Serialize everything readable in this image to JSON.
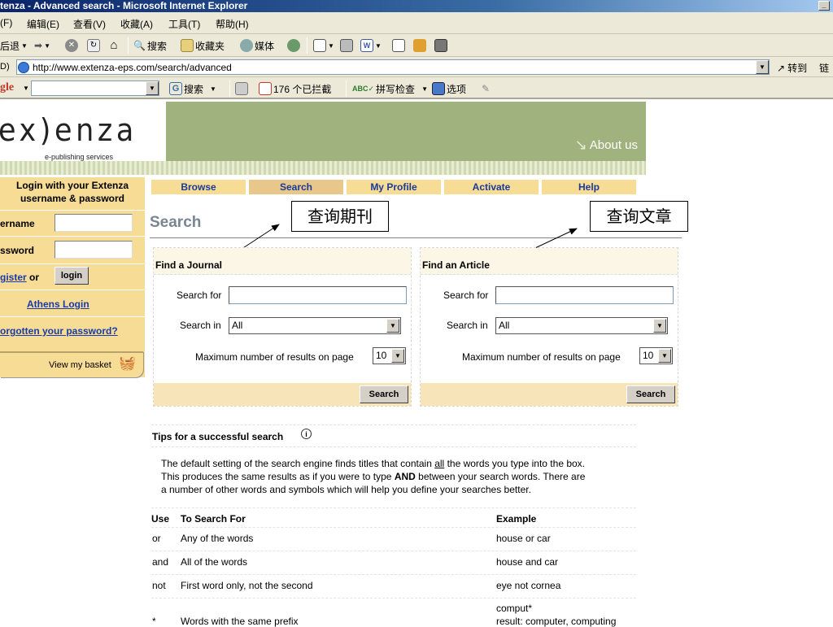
{
  "window": {
    "title": "tenza - Advanced search - Microsoft Internet Explorer"
  },
  "menu": [
    "(F)",
    "编辑(E)",
    "查看(V)",
    "收藏(A)",
    "工具(T)",
    "帮助(H)"
  ],
  "toolbar": {
    "back": "后退",
    "search": "搜索",
    "favorites": "收藏夹",
    "media": "媒体"
  },
  "address": {
    "label": "D)",
    "url": "http://www.extenza-eps.com/search/advanced",
    "go": "转到",
    "links": "链"
  },
  "google_bar": {
    "logo": "gle",
    "search": "搜索",
    "blocked": "176 个已拦截",
    "spell": "拼写检查",
    "options": "选项"
  },
  "site": {
    "logo": "ex)enza",
    "logo_sub": "e-publishing services",
    "about": "About us"
  },
  "login": {
    "heading_line1": "Login with your Extenza",
    "heading_line2": "username & password",
    "username_label": "ername",
    "password_label": "ssword",
    "register": "gister",
    "or": "or",
    "login_button": "login",
    "athens": "Athens Login",
    "forgot": "orgotten your password?",
    "basket": "View my basket"
  },
  "tabs": [
    "Browse",
    "Search",
    "My Profile",
    "Activate",
    "Help"
  ],
  "page_title": "Search",
  "annotations": {
    "journal": "查询期刊",
    "article": "查询文章"
  },
  "journal": {
    "heading": "Find a Journal",
    "search_for": "Search for",
    "search_in": "Search in",
    "search_in_value": "All",
    "max_label": "Maximum number of results on page",
    "max_value": "10",
    "button": "Search"
  },
  "article": {
    "heading": "Find an Article",
    "search_for": "Search for",
    "search_in": "Search in",
    "search_in_value": "All",
    "max_label": "Maximum number of results on page",
    "max_value": "10",
    "button": "Search"
  },
  "tips": {
    "heading": "Tips for a successful search",
    "line1_a": "The default setting of the search engine finds titles that contain ",
    "line1_u": "all",
    "line1_b": " the words you type into the box.",
    "line2_a": "This produces the same results as if you were to type ",
    "line2_b": "AND",
    "line2_c": " between your search words. There are",
    "line3": "a number of other words and symbols which will help you define your searches better."
  },
  "table": {
    "headers": [
      "Use",
      "To Search For",
      "Example"
    ],
    "rows": [
      [
        "or",
        "Any of the words",
        "house or car"
      ],
      [
        "and",
        "All of the words",
        "house and car"
      ],
      [
        "not",
        "First word only, not the second",
        "eye not cornea"
      ],
      [
        "*",
        "Words with the same prefix",
        "comput*"
      ]
    ],
    "row4_example_line2": "result: computer, computing"
  }
}
